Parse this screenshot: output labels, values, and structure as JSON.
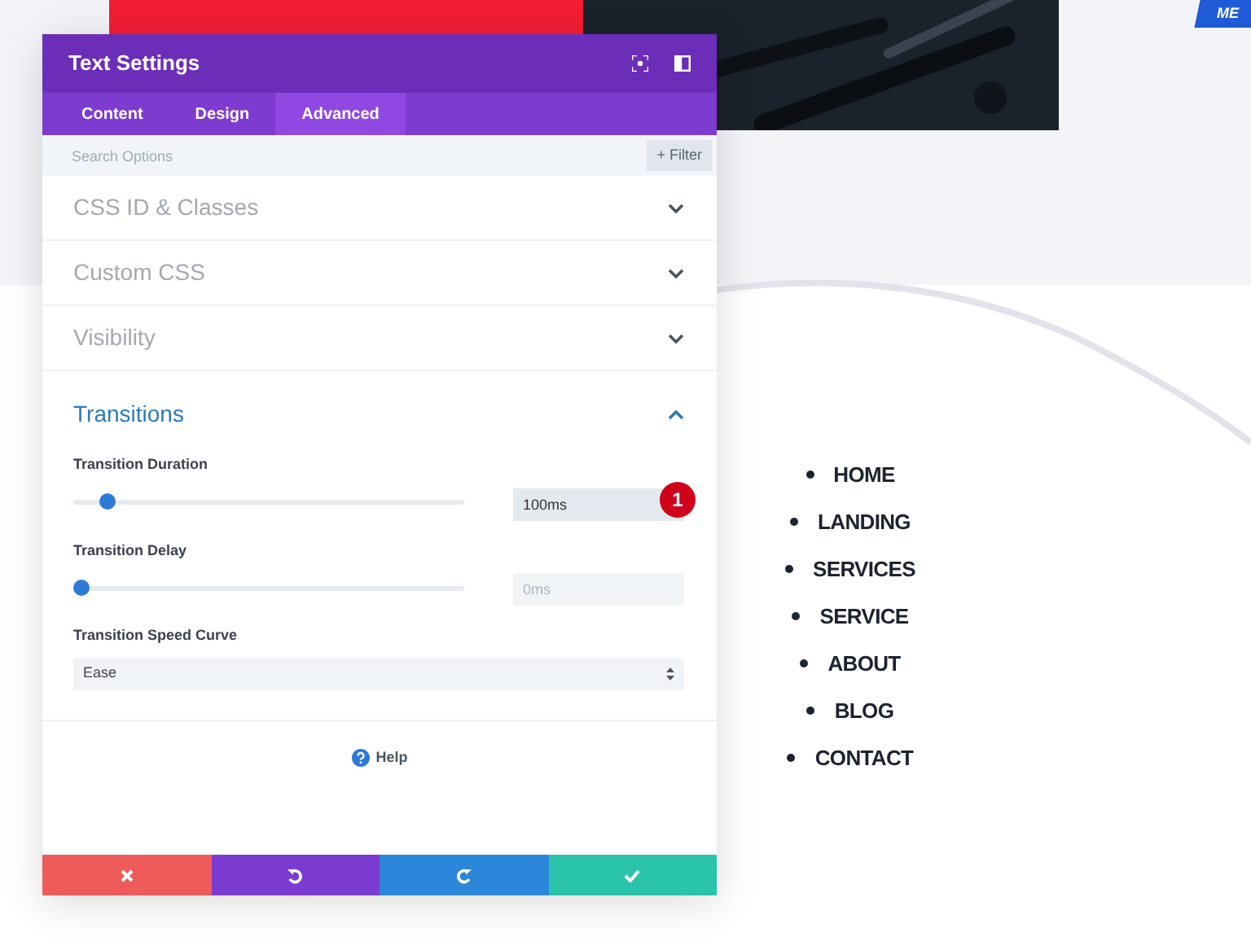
{
  "badge_text": "ME",
  "panel": {
    "title": "Text Settings",
    "tabs": [
      {
        "label": "Content",
        "selected": false
      },
      {
        "label": "Design",
        "selected": false
      },
      {
        "label": "Advanced",
        "selected": true
      }
    ],
    "search": {
      "placeholder": "Search Options"
    },
    "filter_button": {
      "icon": "+",
      "label": "Filter"
    },
    "sections": [
      {
        "title": "CSS ID & Classes",
        "expanded": false
      },
      {
        "title": "Custom CSS",
        "expanded": false
      },
      {
        "title": "Visibility",
        "expanded": false
      },
      {
        "title": "Transitions",
        "expanded": true
      }
    ],
    "fields": [
      {
        "kind": "slider",
        "label": "Transition Duration",
        "level": 0.07,
        "value": "100ms",
        "focused": true,
        "step_badge": "1"
      },
      {
        "kind": "slider",
        "label": "Transition Delay",
        "level": 0,
        "placeholder": "0ms",
        "focused": false
      },
      {
        "kind": "select",
        "label": "Transition Speed Curve",
        "value": "Ease"
      }
    ],
    "help": "Help"
  },
  "nav": [
    "HOME",
    "LANDING",
    "SERVICES",
    "SERVICE",
    "ABOUT",
    "BLOG",
    "CONTACT"
  ]
}
